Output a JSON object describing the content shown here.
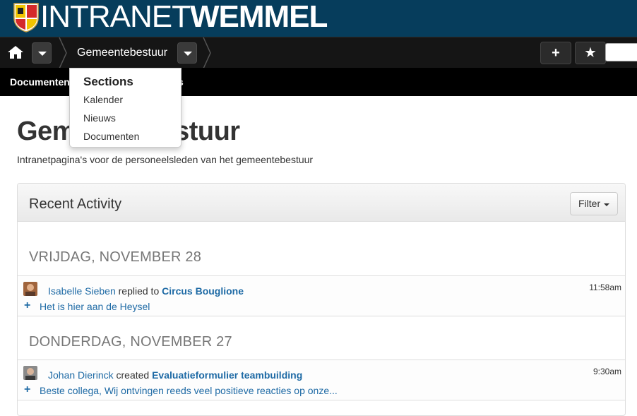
{
  "brand": {
    "thin": "INTRANET",
    "bold": "WEMMEL"
  },
  "navbar": {
    "breadcrumb": "Gemeentebestuur",
    "add_label": "+",
    "star_label": "★"
  },
  "subnav": {
    "items": [
      "Documenten",
      "s"
    ]
  },
  "dropdown": {
    "heading": "Sections",
    "items": [
      "Kalender",
      "Nieuws",
      "Documenten"
    ]
  },
  "page": {
    "title": "Gemeentebestuur",
    "description": "Intranetpagina's voor de personeelsleden van het gemeentebestuur"
  },
  "panel": {
    "title": "Recent Activity",
    "filter_label": "Filter"
  },
  "days": [
    {
      "label": "VRIJDAG, NOVEMBER 28",
      "activity": {
        "user": "Isabelle Sieben",
        "verb": "replied to",
        "target": "Circus Bouglione",
        "time": "11:58am",
        "snippet": "Het is hier aan de Heysel"
      }
    },
    {
      "label": "DONDERDAG, NOVEMBER 27",
      "activity": {
        "user": "Johan Dierinck",
        "verb": "created",
        "target": "Evaluatieformulier teambuilding",
        "time": "9:30am",
        "snippet": "Beste collega,   Wij ontvingen reeds veel positieve reacties op onze..."
      }
    }
  ],
  "icons": {
    "home": "home-icon",
    "plus": "plus-icon",
    "star": "star-icon",
    "caret": "caret-down-icon",
    "shield": "coat-of-arms-icon"
  },
  "colors": {
    "brand_bar": "#063d5c",
    "navbar": "#151515",
    "link": "#1e6aa5"
  }
}
